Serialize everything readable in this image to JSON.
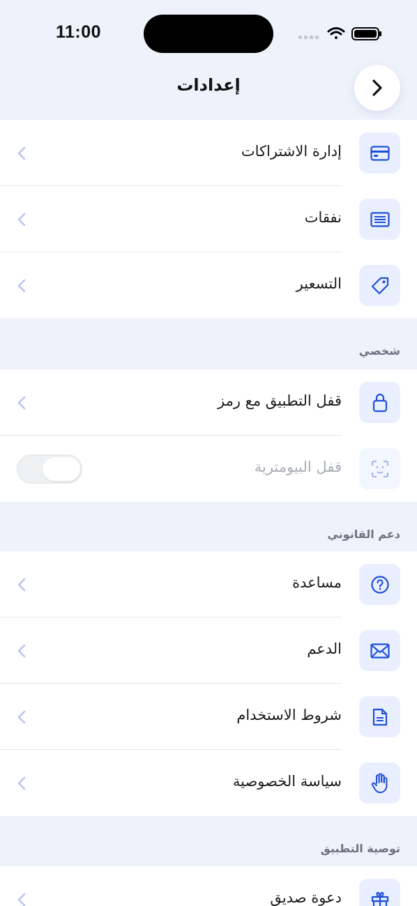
{
  "status_bar": {
    "time": "11:00"
  },
  "nav": {
    "title": "إعدادات"
  },
  "colors": {
    "accent": "#1f4fd8",
    "tile_bg": "#e9efff",
    "page_bg": "#eef2fb"
  },
  "groups": {
    "account": {
      "items": [
        {
          "label": "إدارة الاشتراكات",
          "icon": "credit-card-icon"
        },
        {
          "label": "نفقات",
          "icon": "receipt-icon"
        },
        {
          "label": "التسعير",
          "icon": "tag-icon"
        }
      ]
    },
    "personal": {
      "header": "شخصي",
      "items": [
        {
          "label": "قفل التطبيق مع رمز",
          "icon": "lock-icon"
        },
        {
          "label": "قفل البيومترية",
          "icon": "face-id-icon",
          "toggle": false,
          "disabled": true
        }
      ]
    },
    "support": {
      "header": "دعم القانوني",
      "items": [
        {
          "label": "مساعدة",
          "icon": "help-icon"
        },
        {
          "label": "الدعم",
          "icon": "mail-icon"
        },
        {
          "label": "شروط الاستخدام",
          "icon": "document-icon"
        },
        {
          "label": "سياسة الخصوصية",
          "icon": "hand-icon"
        }
      ]
    },
    "recommend": {
      "header": "توصية التطبيق",
      "items": [
        {
          "label": "دعوة صديق",
          "icon": "gift-icon"
        }
      ]
    }
  }
}
